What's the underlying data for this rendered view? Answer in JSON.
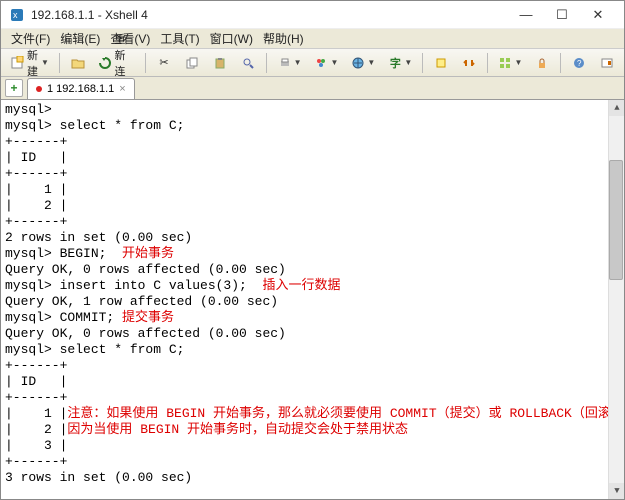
{
  "window": {
    "title": "192.168.1.1 - Xshell 4"
  },
  "menu": {
    "file": "文件(F)",
    "edit": "编辑(E)",
    "view": "查看(V)",
    "tools": "工具(T)",
    "window": "窗口(W)",
    "help": "帮助(H)"
  },
  "toolbar": {
    "new": "新建",
    "reconnect": "重新连接"
  },
  "tab": {
    "label": "1 192.168.1.1"
  },
  "terminal": {
    "lines": [
      {
        "t": "mysql>"
      },
      {
        "t": "mysql> select * from C;"
      },
      {
        "t": "+------+"
      },
      {
        "t": "| ID   |"
      },
      {
        "t": "+------+"
      },
      {
        "t": "|    1 |"
      },
      {
        "t": "|    2 |"
      },
      {
        "t": "+------+"
      },
      {
        "t": "2 rows in set (0.00 sec)"
      },
      {
        "t": ""
      },
      {
        "t": "mysql> BEGIN;  ",
        "r": "开始事务"
      },
      {
        "t": "Query OK, 0 rows affected (0.00 sec)"
      },
      {
        "t": ""
      },
      {
        "t": "mysql> insert into C values(3);  ",
        "r": "插入一行数据"
      },
      {
        "t": "Query OK, 1 row affected (0.00 sec)"
      },
      {
        "t": ""
      },
      {
        "t": "mysql> COMMIT; ",
        "r": "提交事务"
      },
      {
        "t": "Query OK, 0 rows affected (0.00 sec)"
      },
      {
        "t": ""
      },
      {
        "t": "mysql> select * from C;"
      },
      {
        "t": "+------+"
      },
      {
        "t": "| ID   |"
      },
      {
        "t": "+------+"
      },
      {
        "t": "|    1 |",
        "r": "注意：如果使用 BEGIN 开始事务，那么就必须要使用 COMMIT（提交）或 ROLLBACK（回滚），"
      },
      {
        "t": "|    2 |",
        "r": "因为当使用 BEGIN 开始事务时，自动提交会处于禁用状态"
      },
      {
        "t": "|    3 |"
      },
      {
        "t": "+------+"
      },
      {
        "t": "3 rows in set (0.00 sec)"
      }
    ]
  }
}
